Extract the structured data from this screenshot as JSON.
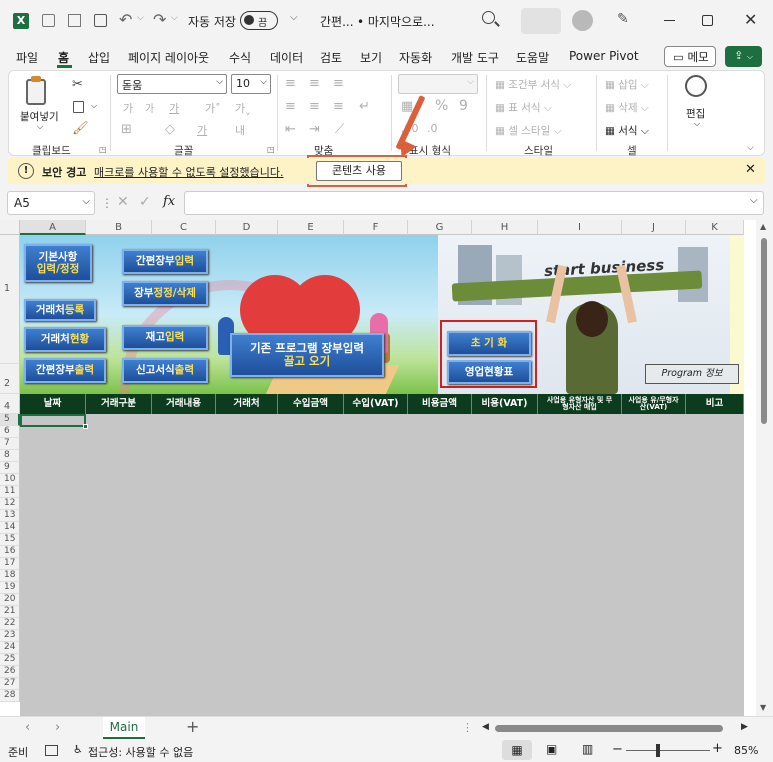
{
  "title": {
    "autosave": "자동 저장",
    "toggle": "끔",
    "doc1": "간편...",
    "doc2": "• 마지막으로..."
  },
  "menu": {
    "items": [
      "파일",
      "홈",
      "삽입",
      "페이지 레이아웃",
      "수식",
      "데이터",
      "검토",
      "보기",
      "자동화",
      "개발 도구",
      "도움말",
      "Power Pivot"
    ],
    "memo": "메모"
  },
  "ribbon": {
    "paste": "붙여넣기",
    "font_name": "돋움",
    "font_size": "10",
    "groups": [
      "클립보드",
      "글꼴",
      "맞춤",
      "표시 형식",
      "스타일",
      "셀",
      "편집"
    ],
    "style_items": [
      "조건부 서식",
      "표 서식",
      "셀 스타일"
    ],
    "cell_items": [
      "삽입",
      "삭제",
      "서식"
    ],
    "edit": "편집"
  },
  "security": {
    "title": "보안 경고",
    "message": "매크로를 사용할 수 없도록 설정했습니다.",
    "button": "콘텐츠 사용"
  },
  "formula": {
    "namebox": "A5",
    "fx": "fx",
    "value": ""
  },
  "columns": [
    "A",
    "B",
    "C",
    "D",
    "E",
    "F",
    "G",
    "H",
    "I",
    "J",
    "K"
  ],
  "rows": [
    "1",
    "2",
    "4",
    "5",
    "6",
    "7",
    "8",
    "9",
    "10",
    "11",
    "12",
    "13",
    "14",
    "15",
    "16",
    "17",
    "18",
    "19",
    "20",
    "21",
    "22",
    "23",
    "24",
    "25",
    "26",
    "27",
    "28"
  ],
  "buttons": {
    "basic": [
      "기본사항",
      "입력/정정"
    ],
    "simple_input": [
      "간편장부 ",
      "입력"
    ],
    "book_edit": [
      "장부 ",
      "정정/삭제"
    ],
    "partner_reg": [
      "거래처 ",
      "등록"
    ],
    "partner_status": [
      "거래처 ",
      "현황"
    ],
    "stock_input": [
      "재고 ",
      "입력"
    ],
    "simple_print": [
      "간편장부 ",
      "출력"
    ],
    "form_print": [
      "신고서식 ",
      "출력"
    ],
    "import": [
      "기존 프로그램 장부입력",
      "끌고 오기"
    ],
    "reset": "초 기 화",
    "biz_status": "영업현황표",
    "program": "Program 정보"
  },
  "banner_text": "start business",
  "table_headers": [
    "날짜",
    "거래구분",
    "거래내용",
    "거래처",
    "수입금액",
    "수입(VAT)",
    "비용금액",
    "비용(VAT)",
    "사업용 유형자산 및 무형자산 매입",
    "사업용 유/무형자산(VAT)",
    "비고"
  ],
  "sheet_tab": "Main",
  "status": {
    "ready": "준비",
    "accessibility": "접근성: 사용할 수 없음",
    "zoom": "85%"
  }
}
